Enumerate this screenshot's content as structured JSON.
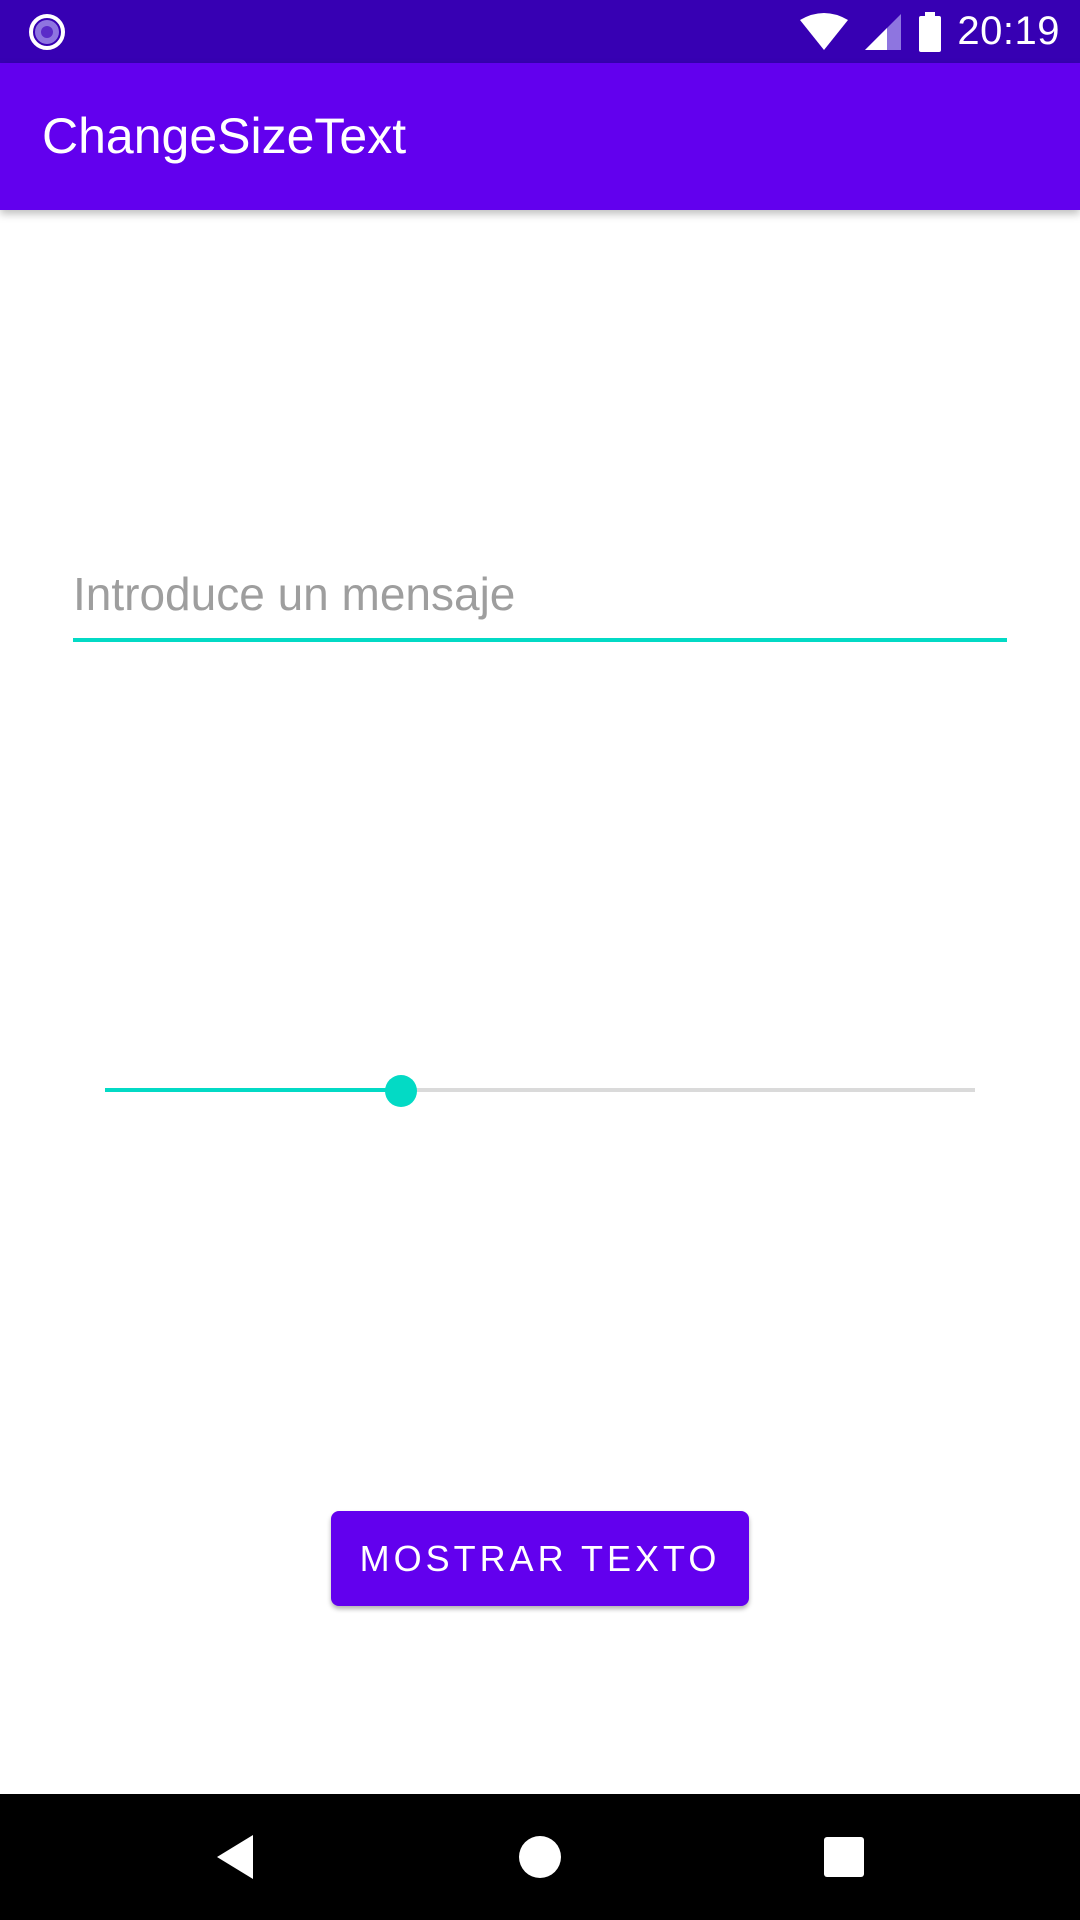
{
  "status_bar": {
    "time": "20:19",
    "icons": [
      "app-notification-icon",
      "wifi-icon",
      "signal-icon",
      "battery-icon"
    ]
  },
  "app_bar": {
    "title": "ChangeSizeText"
  },
  "main": {
    "message_input": {
      "placeholder": "Introduce un mensaje",
      "value": ""
    },
    "size_slider": {
      "value_fraction": 0.34
    },
    "show_button": {
      "label": "MOSTRAR TEXTO"
    }
  },
  "nav_bar": {
    "buttons": [
      "back-icon",
      "home-icon",
      "recents-icon"
    ]
  },
  "colors": {
    "status_bar": "#3700B3",
    "primary": "#6200EE",
    "accent": "#03DAC5",
    "placeholder": "#9E9E9E",
    "track": "#DADADA"
  }
}
